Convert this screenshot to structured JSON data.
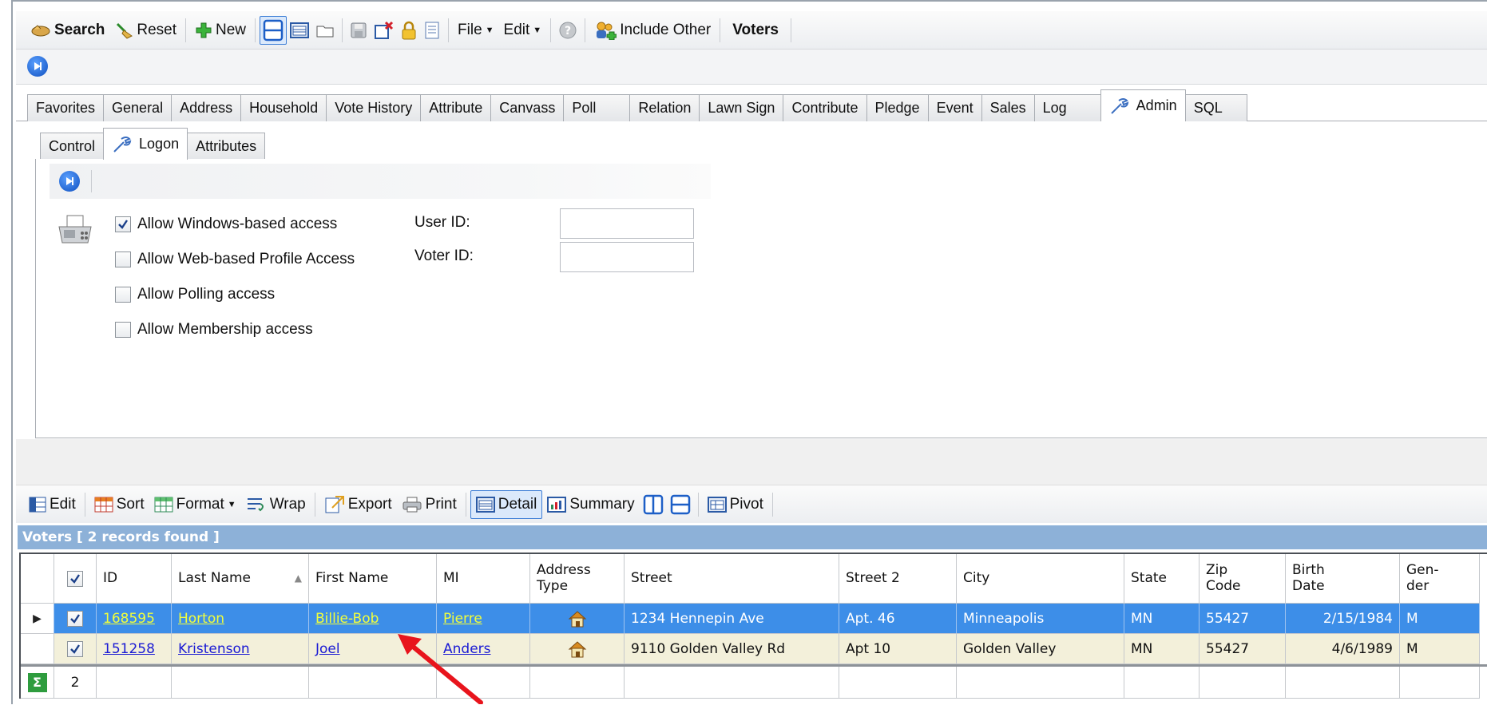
{
  "toolbar": {
    "search": "Search",
    "reset": "Reset",
    "new": "New",
    "file": "File",
    "edit": "Edit",
    "include_other": "Include Other",
    "voters": "Voters"
  },
  "main_tabs": [
    "Favorites",
    "General",
    "Address",
    "Household",
    "Vote History",
    "Attribute",
    "Canvass",
    "Poll",
    "Relation",
    "Lawn Sign",
    "Contribute",
    "Pledge",
    "Event",
    "Sales",
    "Log",
    "Admin",
    "SQL"
  ],
  "sub_tabs": [
    "Control",
    "Logon",
    "Attributes"
  ],
  "logon": {
    "checks": [
      {
        "label": "Allow Windows-based access",
        "checked": true
      },
      {
        "label": "Allow Web-based Profile Access",
        "checked": false
      },
      {
        "label": "Allow Polling access",
        "checked": false
      },
      {
        "label": "Allow Membership access",
        "checked": false
      }
    ],
    "user_id_label": "User ID:",
    "voter_id_label": "Voter ID:",
    "user_id_value": "",
    "voter_id_value": ""
  },
  "grid_toolbar": {
    "edit": "Edit",
    "sort": "Sort",
    "format": "Format",
    "wrap": "Wrap",
    "export": "Export",
    "print": "Print",
    "detail": "Detail",
    "summary": "Summary",
    "pivot": "Pivot"
  },
  "grid": {
    "title": "Voters [ 2 records found ]",
    "headers": {
      "id": "ID",
      "last": "Last Name",
      "first": "First Name",
      "mi": "MI",
      "addr_type_1": "Address",
      "addr_type_2": "Type",
      "street": "Street",
      "street2": "Street 2",
      "city": "City",
      "state": "State",
      "zip_1": "Zip",
      "zip_2": "Code",
      "birth_1": "Birth",
      "birth_2": "Date",
      "gender_1": "Gen-",
      "gender_2": "der"
    },
    "rows": [
      {
        "id": "168595",
        "last": "Horton",
        "first": "Billie-Bob",
        "mi": "Pierre",
        "street": "1234 Hennepin Ave",
        "street2": "Apt. 46",
        "city": "Minneapolis",
        "state": "MN",
        "zip": "55427",
        "birth": "2/15/1984",
        "gender": "M"
      },
      {
        "id": "151258",
        "last": "Kristenson",
        "first": "Joel",
        "mi": "Anders",
        "street": "9110 Golden Valley Rd",
        "street2": "Apt 10",
        "city": "Golden Valley",
        "state": "MN",
        "zip": "55427",
        "birth": "4/6/1989",
        "gender": "M"
      }
    ],
    "footer_count": "2"
  },
  "colors": {
    "selected_row": "#3d8ee8",
    "alt_row": "#f3f0da",
    "header_bar": "#8db1d8",
    "arrow": "#e8141c"
  }
}
